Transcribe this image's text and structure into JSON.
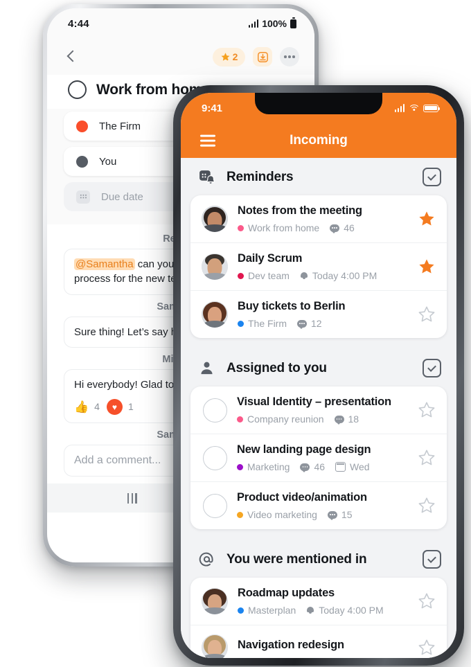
{
  "theme": {
    "accent_orange": "#f47b20",
    "heart_red": "#f6502a",
    "thumb_blue": "#1f86f0",
    "mention_bg": "#ffdcb4"
  },
  "back_phone": {
    "status": {
      "time": "4:44",
      "battery": "100%",
      "signal_icon": "signal-bars-icon",
      "battery_icon": "battery-icon"
    },
    "toolbar": {
      "back_icon": "back-chevron-icon",
      "pin_icon": "star-pin-icon",
      "pin_count": "2",
      "download_icon": "download-box-icon",
      "more_icon": "more-dots-icon"
    },
    "task": {
      "complete_icon": "circle-checkbox-icon",
      "title": "Work from home"
    },
    "chips": [
      {
        "label": "The Firm",
        "color": "#fa4e2b",
        "icon": "project-dot-icon",
        "type": "project"
      },
      {
        "label": "You",
        "color": "#565c64",
        "icon": "assignee-dot-icon",
        "type": "assignee"
      },
      {
        "label": "Due date",
        "color": "",
        "icon": "calendar-icon",
        "type": "duedate"
      }
    ],
    "comments": [
      {
        "author": "Rebeca",
        "mention": "@Samantha",
        "text": " can you l",
        "text2": "process for the new te"
      },
      {
        "author": "Samantha",
        "text": "Sure thing! Let’s say he"
      },
      {
        "author": "Michael",
        "text": "Hi everybody! Glad to b",
        "reactions": [
          {
            "icon": "thumbs-up-icon",
            "glyph": "👍",
            "count": "4"
          },
          {
            "icon": "heart-icon",
            "glyph": "♥",
            "count": "1"
          }
        ]
      }
    ],
    "composer": {
      "author": "Samantha",
      "placeholder": "Add a comment..."
    },
    "navbar": {
      "recents_icon": "recents-icon",
      "home_icon": "home-circle-icon"
    }
  },
  "front_phone": {
    "status": {
      "time": "9:41",
      "signal_icon": "signal-bars-icon",
      "wifi_icon": "wifi-icon",
      "battery_icon": "battery-icon"
    },
    "header": {
      "menu_icon": "hamburger-menu-icon",
      "title": "Incoming"
    },
    "sections": [
      {
        "title": "Reminders",
        "icon": "calendar-bell-icon",
        "action_icon": "check-square-icon",
        "rows": [
          {
            "lead": "avatar",
            "avatar": "avatar-woman-dark-hair",
            "title": "Notes from the meeting",
            "meta": [
              {
                "type": "project",
                "label": "Work from home",
                "color": "#fb5a8a",
                "icon": "project-dot-icon"
              },
              {
                "type": "comments",
                "label": "46",
                "icon": "comment-bubble-icon"
              }
            ],
            "starred": true,
            "star_icon": "star-filled-icon"
          },
          {
            "lead": "avatar",
            "avatar": "avatar-man-short-hair",
            "title": "Daily Scrum",
            "meta": [
              {
                "type": "project",
                "label": "Dev team",
                "color": "#e0174f",
                "icon": "project-dot-icon"
              },
              {
                "type": "reminder",
                "label": "Today 4:00 PM",
                "icon": "bell-icon"
              }
            ],
            "starred": true,
            "star_icon": "star-filled-icon"
          },
          {
            "lead": "avatar",
            "avatar": "avatar-woman-brown-hair",
            "title": "Buy tickets to Berlin",
            "meta": [
              {
                "type": "project",
                "label": "The Firm",
                "color": "#1b84ef",
                "icon": "project-dot-icon"
              },
              {
                "type": "comments",
                "label": "12",
                "icon": "comment-bubble-icon"
              }
            ],
            "starred": false,
            "star_icon": "star-outline-icon"
          }
        ]
      },
      {
        "title": "Assigned to you",
        "icon": "person-icon",
        "action_icon": "check-square-icon",
        "rows": [
          {
            "lead": "checkbox",
            "checkbox_icon": "task-checkbox-icon",
            "title": "Visual Identity – presentation",
            "meta": [
              {
                "type": "project",
                "label": "Company reunion",
                "color": "#fb5a8a",
                "icon": "project-dot-icon"
              },
              {
                "type": "comments",
                "label": "18",
                "icon": "comment-bubble-icon"
              }
            ],
            "starred": false,
            "star_icon": "star-outline-icon"
          },
          {
            "lead": "checkbox",
            "checkbox_icon": "task-checkbox-icon",
            "title": "New landing page design",
            "meta": [
              {
                "type": "project",
                "label": "Marketing",
                "color": "#9b10c9",
                "icon": "project-dot-icon"
              },
              {
                "type": "comments",
                "label": "46",
                "icon": "comment-bubble-icon"
              },
              {
                "type": "date",
                "label": "Wed",
                "icon": "calendar-icon"
              }
            ],
            "starred": false,
            "star_icon": "star-outline-icon"
          },
          {
            "lead": "checkbox",
            "checkbox_icon": "task-checkbox-icon",
            "title": "Product video/animation",
            "meta": [
              {
                "type": "project",
                "label": "Video marketing",
                "color": "#f5a623",
                "icon": "project-dot-icon"
              },
              {
                "type": "comments",
                "label": "15",
                "icon": "comment-bubble-icon"
              }
            ],
            "starred": false,
            "star_icon": "star-outline-icon"
          }
        ]
      },
      {
        "title": "You were mentioned in",
        "icon": "at-mention-icon",
        "action_icon": "check-square-icon",
        "rows": [
          {
            "lead": "avatar",
            "avatar": "avatar-woman-glasses",
            "title": "Roadmap updates",
            "meta": [
              {
                "type": "project",
                "label": "Masterplan",
                "color": "#1b84ef",
                "icon": "project-dot-icon"
              },
              {
                "type": "reminder",
                "label": "Today 4:00 PM",
                "icon": "bell-icon"
              }
            ],
            "starred": false,
            "star_icon": "star-outline-icon"
          },
          {
            "lead": "avatar",
            "avatar": "avatar-woman-blonde",
            "title": "Navigation redesign",
            "meta": [],
            "starred": false,
            "star_icon": "star-outline-icon"
          }
        ]
      }
    ]
  }
}
